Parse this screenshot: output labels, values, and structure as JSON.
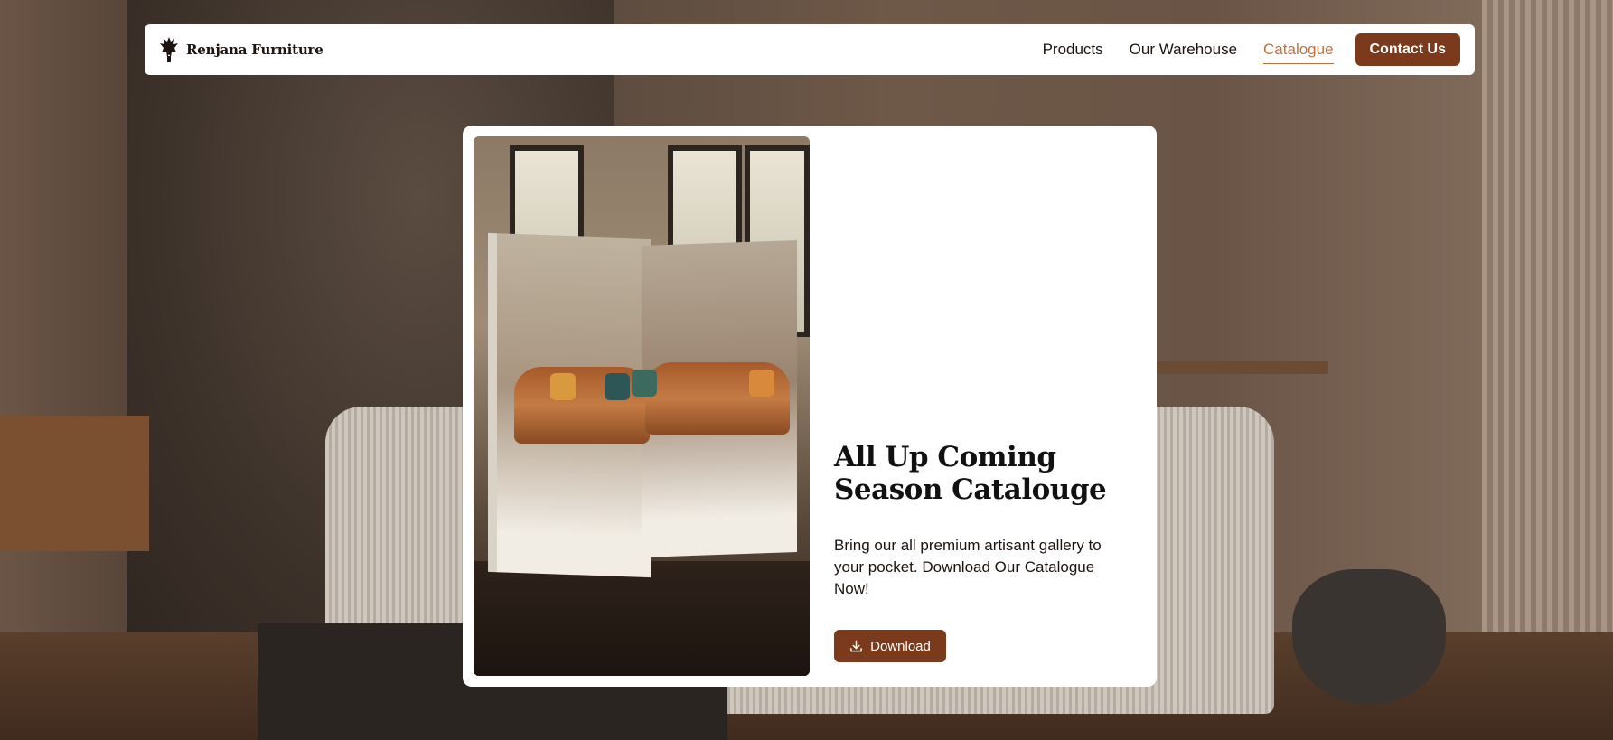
{
  "brand": {
    "name": "Renjana Furniture",
    "logo_icon": "furniture-crest-icon"
  },
  "nav": {
    "items": [
      {
        "label": "Products",
        "active": false
      },
      {
        "label": "Our Warehouse",
        "active": false
      },
      {
        "label": "Catalogue",
        "active": true
      }
    ],
    "contact_label": "Contact Us"
  },
  "card": {
    "title": "All Up Coming Season Catalouge",
    "description": "Bring our all premium artisant gallery to your pocket. Download Our Catalogue Now!",
    "download_label": "Download",
    "download_icon": "download-icon"
  },
  "colors": {
    "accent": "#7b3a1b",
    "active_link": "#c4703d",
    "text": "#1d1410"
  }
}
